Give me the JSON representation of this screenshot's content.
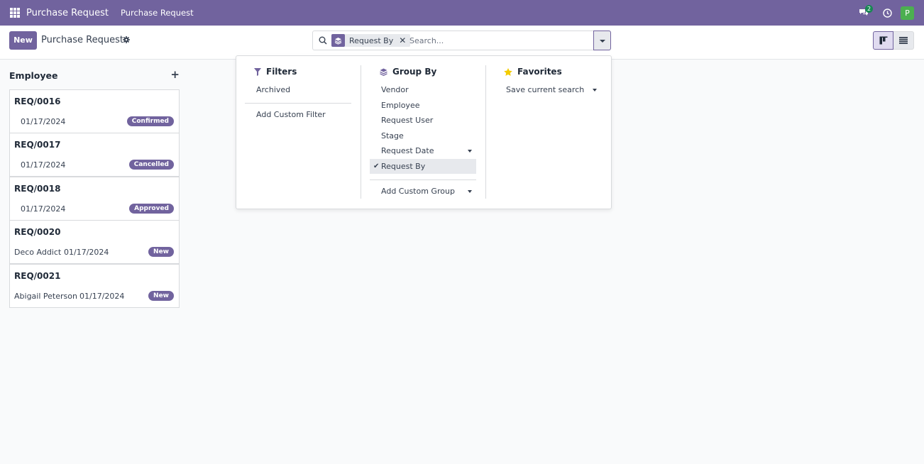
{
  "navbar": {
    "brand": "Purchase Request",
    "menu": [
      "Purchase Request"
    ],
    "chat_badge": "2",
    "avatar_letter": "P",
    "icons": [
      "apps-icon",
      "chat-icon",
      "clock-icon"
    ]
  },
  "control_panel": {
    "new_label": "New",
    "title": "Purchase Request",
    "search": {
      "facet_label": "Request By",
      "placeholder": "Search..."
    }
  },
  "kanban": {
    "column_title": "Employee",
    "add_symbol": "+",
    "cards": [
      {
        "ref": "REQ/0016",
        "employee": "",
        "date": "01/17/2024",
        "status": "Confirmed"
      },
      {
        "ref": "REQ/0017",
        "employee": "",
        "date": "01/17/2024",
        "status": "Cancelled"
      },
      {
        "ref": "REQ/0018",
        "employee": "",
        "date": "01/17/2024",
        "status": "Approved"
      },
      {
        "ref": "REQ/0020",
        "employee": "Deco Addict",
        "date": "01/17/2024",
        "status": "New"
      },
      {
        "ref": "REQ/0021",
        "employee": "Abigail Peterson",
        "date": "01/17/2024",
        "status": "New"
      }
    ]
  },
  "dropdown": {
    "filters": {
      "title": "Filters",
      "items": [
        "Archived"
      ],
      "custom": "Add Custom Filter"
    },
    "group_by": {
      "title": "Group By",
      "items": [
        "Vendor",
        "Employee",
        "Request User",
        "Stage",
        "Request Date",
        "Request By"
      ],
      "selected": "Request By",
      "custom": "Add Custom Group"
    },
    "favorites": {
      "title": "Favorites",
      "items": [
        "Save current search"
      ]
    }
  },
  "colors": {
    "brand": "#71639e",
    "avatar": "#4caf50",
    "badge": "#198754",
    "star": "#f3cc00"
  }
}
